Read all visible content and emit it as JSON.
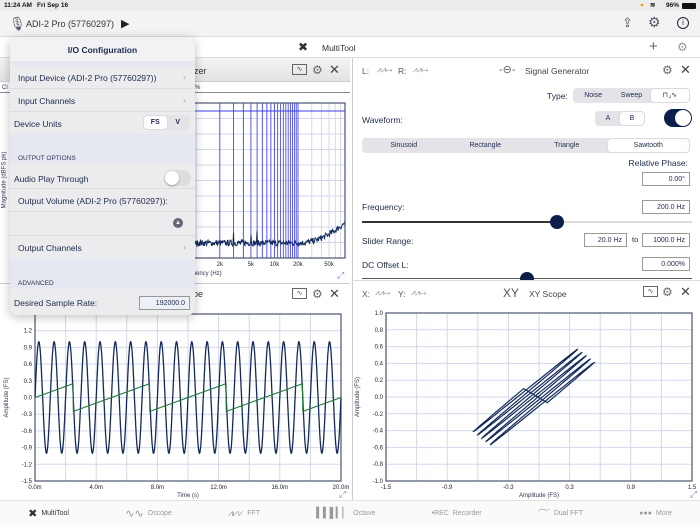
{
  "status": {
    "time": "11:24 AM",
    "date": "Fri Sep 16",
    "battery": "96%"
  },
  "appbar": {
    "device": "ADI-2 Pro (57760297)",
    "icons": [
      "mic-icon",
      "play-icon",
      "share-icon",
      "settings-icon",
      "info-icon"
    ]
  },
  "bar2": {
    "title": "MultiTool",
    "icons": [
      "multitool-icon",
      "plus-icon",
      "gear-icon"
    ]
  },
  "fft": {
    "title_visible": "zer",
    "left_tag": "Cl",
    "pct_tag": "%",
    "ylabel": "Magnitude (dBFS pk)"
  },
  "popover": {
    "title": "I/O Configuration",
    "input_device": "Input Device (ADI-2 Pro (57760297))",
    "input_channels": "Input Channels",
    "device_units": "Device Units",
    "units": [
      "FS",
      "V"
    ],
    "units_selected": "FS",
    "output_options": "OUTPUT OPTIONS",
    "play_through": "Audio Play Through",
    "play_through_on": false,
    "output_volume": "Output Volume (ADI-2 Pro (57760297)):",
    "output_channels": "Output Channels",
    "advanced": "ADVANCED",
    "sample_rate_label": "Desired Sample Rate:",
    "sample_rate": "192000.0"
  },
  "siggen": {
    "l": "L:",
    "r": "R:",
    "title": "Signal Generator",
    "type_label": "Type:",
    "types": [
      "Noise",
      "Sweep",
      "⊓⌟∿"
    ],
    "type_selected": 2,
    "waveform_label": "Waveform:",
    "ab": [
      "A",
      "B"
    ],
    "ab_selected": "B",
    "enabled": true,
    "waves": [
      "Sinusoid",
      "Rectangle",
      "Triangle",
      "Sawtooth"
    ],
    "wave_selected": "Sawtooth",
    "phase_label": "Relative Phase:",
    "phase": "0.00°",
    "freq_label": "Frequency:",
    "freq": "200.0 Hz",
    "freq_slider_fraction": 0.59,
    "range_label": "Slider Range:",
    "range_from": "20.0 Hz",
    "range_to_word": "to",
    "range_to": "1000.0 Hz",
    "dc_label": "DC Offset L:",
    "dc": "0.000%",
    "dc_slider_fraction": 0.5
  },
  "oscope_head": {
    "title_visible": "pe"
  },
  "xy_head": {
    "x": "X:",
    "y": "Y:",
    "glyph": "XY",
    "title": "XY Scope"
  },
  "tabs": [
    {
      "label": "MultiTool",
      "icon": "multitool-icon",
      "active": true
    },
    {
      "label": "Oscope",
      "icon": "oscope-icon"
    },
    {
      "label": "FFT",
      "icon": "fft-icon"
    },
    {
      "label": "Octave",
      "icon": "octave-icon"
    },
    {
      "label": "Recorder",
      "icon": "rec-icon",
      "prefix": "•REC"
    },
    {
      "label": "Dual FFT",
      "icon": "dualfft-icon"
    },
    {
      "label": "More",
      "icon": "more-icon"
    }
  ],
  "chart_data": [
    {
      "type": "line",
      "name": "fft",
      "xscale": "log",
      "xlim": [
        10,
        80000
      ],
      "xticks": [
        "2k",
        "5k",
        "10k",
        "20k",
        "50k"
      ],
      "xtick_values": [
        2000,
        5000,
        10000,
        20000,
        50000
      ],
      "xlabel": "Frequency (Hz)",
      "ylabel": "Magnitude (dBFS pk)",
      "harmonic_markers_hz": [
        2000,
        3000,
        4000,
        5000,
        6000,
        7000,
        8000,
        9000,
        10000,
        11000,
        12000,
        13000,
        14000,
        15000,
        16000,
        17000,
        18000,
        19000,
        20000
      ],
      "grid": true,
      "colors": {
        "trace": "#142a5c",
        "markers": "#3b3bf0"
      }
    },
    {
      "type": "line",
      "name": "oscope",
      "xlim": [
        0,
        20
      ],
      "ylim": [
        -1.5,
        1.5
      ],
      "xticks": [
        "0.0m",
        "4.0m",
        "8.0m",
        "12.0m",
        "16.0m",
        "20.0m"
      ],
      "yticks": [
        "1.2",
        "0.9",
        "0.6",
        "0.3",
        "0.0",
        "-0.3",
        "-0.6",
        "-0.9",
        "-1.2",
        "-1.5"
      ],
      "xlabel": "Time (s)",
      "ylabel": "Amplitude (FS)",
      "grid": true,
      "series": [
        {
          "shape": "sine",
          "frequency_hz": 1000,
          "amplitude": 1.0,
          "color": "#142a5c"
        },
        {
          "shape": "sawtooth",
          "frequency_hz": 200,
          "amplitude": 0.25,
          "color": "#1f7a3a"
        }
      ]
    },
    {
      "type": "line",
      "name": "xy",
      "xlim": [
        -1.5,
        1.5
      ],
      "ylim": [
        -1,
        1
      ],
      "xticks": [
        "-1.5",
        "-0.9",
        "-0.3",
        "0.3",
        "0.9",
        "1.5"
      ],
      "yticks": [
        "1.0",
        "0.8",
        "0.6",
        "0.4",
        "0.2",
        "0.0",
        "-0.2",
        "-0.4",
        "-0.6",
        "-0.8",
        "-1.0"
      ],
      "xlabel": "Amplitude (FS)",
      "ylabel": "Amplitude (FS)",
      "grid": true,
      "color": "#142a5c"
    }
  ]
}
